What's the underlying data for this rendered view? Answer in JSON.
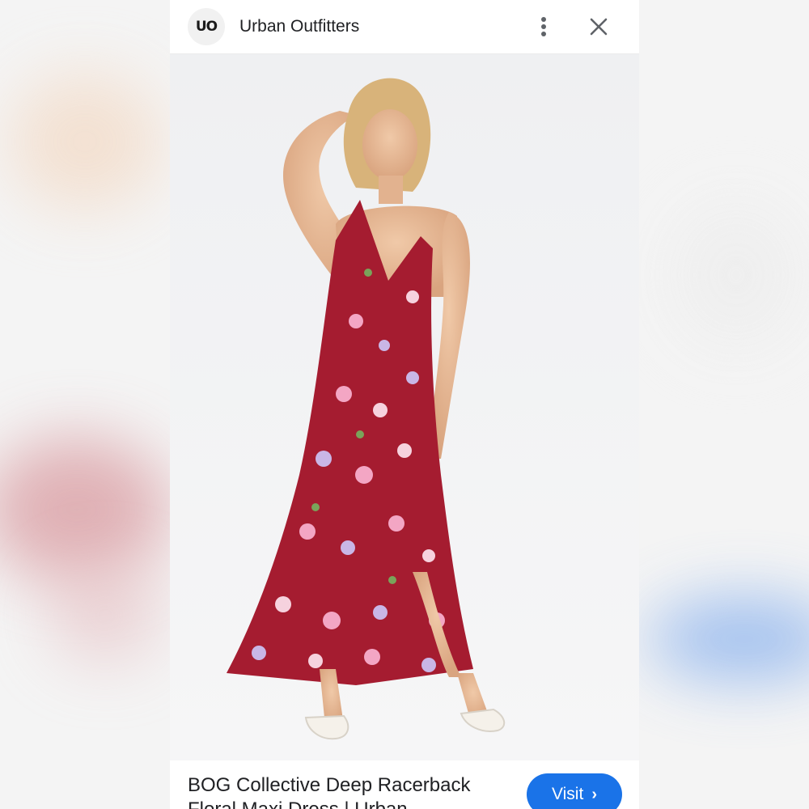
{
  "header": {
    "avatar_text": "UO",
    "site_name": "Urban Outfitters"
  },
  "image": {
    "alt": "Model wearing a red floral maxi dress with white sandals"
  },
  "footer": {
    "title": "BOG Collective Deep Racerback Floral Maxi Dress | Urban",
    "visit_label": "Visit",
    "visit_chevron": "›"
  },
  "colors": {
    "accent": "#1a73e8",
    "dress": "#a51c30",
    "floral_pink": "#f3a6c4",
    "floral_lilac": "#c9b6e6",
    "sandals": "#f5f1ea"
  },
  "icons": {
    "more": "more-vert-icon",
    "close": "close-icon"
  }
}
